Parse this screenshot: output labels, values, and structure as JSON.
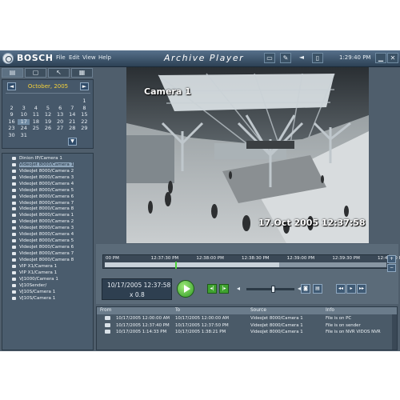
{
  "titlebar": {
    "brand": "BOSCH",
    "menu": [
      "File",
      "Edit",
      "View",
      "Help"
    ],
    "app_title": "Archive Player",
    "clock": "1:29:40 PM"
  },
  "left_tabs": [
    "calendar-tab",
    "folder-tab",
    "export-tab",
    "settings-tab"
  ],
  "calendar": {
    "month_label": "October, 2005",
    "weekday_headers": [
      "",
      "",
      "",
      "",
      "",
      "",
      ""
    ],
    "days": [
      "",
      "",
      "",
      "",
      "",
      "",
      "1",
      "2",
      "3",
      "4",
      "5",
      "6",
      "7",
      "8",
      "9",
      "10",
      "11",
      "12",
      "13",
      "14",
      "15",
      "16",
      "17",
      "18",
      "19",
      "20",
      "21",
      "22",
      "23",
      "24",
      "25",
      "26",
      "27",
      "28",
      "29",
      "30",
      "31",
      "",
      "",
      "",
      "",
      ""
    ],
    "selected_day": "17"
  },
  "cameras": [
    "Dinion IP/Camera 1",
    "VideoJet 8000/Camera 1",
    "VideoJet 8000/Camera 2",
    "VideoJet 8000/Camera 3",
    "VideoJet 8000/Camera 4",
    "VideoJet 8000/Camera 5",
    "VideoJet 8000/Camera 6",
    "VideoJet 8000/Camera 7",
    "VideoJet 8000/Camera 8",
    "VideoJet 8000/Camera 1",
    "VideoJet 8000/Camera 2",
    "VideoJet 8000/Camera 3",
    "VideoJet 8000/Camera 4",
    "VideoJet 8000/Camera 5",
    "VideoJet 8000/Camera 6",
    "VideoJet 8000/Camera 7",
    "VideoJet 8000/Camera 8",
    "VIP X1/Camera 1",
    "VIP X1/Camera 1",
    "VJ1000/Camera 1",
    "VJ10Sender/",
    "VJ10S/Camera 1",
    "VJ10S/Camera 1"
  ],
  "video": {
    "camera_label": "Camera 1",
    "timestamp_overlay": "17.Oct 2005 12:37:58"
  },
  "timeline": {
    "ticks": [
      "00 PM",
      "12:37:30 PM",
      "12:38:00 PM",
      "12:38:30 PM",
      "12:39:00 PM",
      "12:39:30 PM",
      "12:40:00 PM"
    ],
    "recorded_fraction": 0.62,
    "cursor_fraction": 0.25
  },
  "playback": {
    "datetime": "10/17/2005 12:37:58",
    "speed": "x 0.8",
    "volume_fraction": 0.55
  },
  "events_table": {
    "headers": [
      "From",
      "To",
      "Source",
      "Info"
    ],
    "rows": [
      {
        "from": "10/17/2005 12:00:00 AM",
        "to": "10/17/2005 12:00:00 AM",
        "source": "VideoJet 8000/Camera 1",
        "info": "File is on PC"
      },
      {
        "from": "10/17/2005 12:37:40 PM",
        "to": "10/17/2005 12:37:50 PM",
        "source": "VideoJet 8000/Camera 1",
        "info": "File is on sender"
      },
      {
        "from": "10/17/2005 1:14:33 PM",
        "to": "10/17/2005 1:38:21 PM",
        "source": "VideoJet 8000/Camera 1",
        "info": "File is on NVR VIDOS NVR"
      }
    ]
  },
  "colors": {
    "window_bg": "#4f5e6c",
    "titlebar": "#2d4155",
    "play_green": "#3fa22f",
    "month_yellow": "#f5d23a"
  }
}
